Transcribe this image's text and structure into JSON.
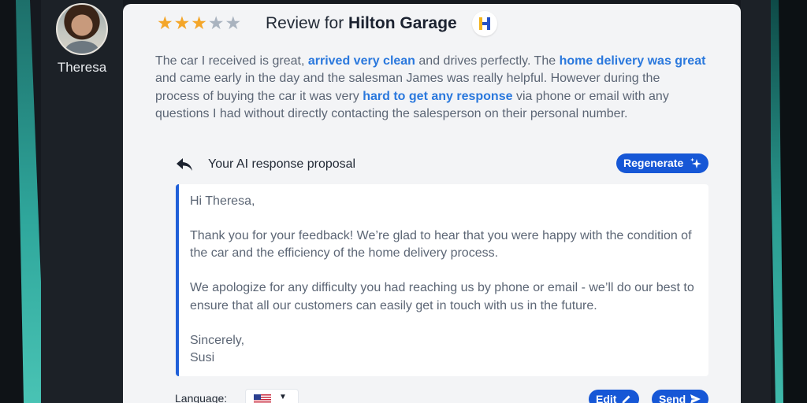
{
  "reviewer": {
    "name": "Theresa"
  },
  "review": {
    "rating": 3,
    "max_rating": 5,
    "title_prefix": "Review for",
    "business_name": "Hilton Garage",
    "text_segments": [
      {
        "text": "The car I received is great, ",
        "highlight": false
      },
      {
        "text": "arrived very clean",
        "highlight": true
      },
      {
        "text": " and drives perfectly. The ",
        "highlight": false
      },
      {
        "text": "home delivery was great",
        "highlight": true
      },
      {
        "text": " and came early in the day and the salesman James was really helpful. However during the process of buying the car it was very ",
        "highlight": false
      },
      {
        "text": "hard to get any response",
        "highlight": true
      },
      {
        "text": " via phone or email with any questions I had without directly contacting the salesperson on their personal number.",
        "highlight": false
      }
    ]
  },
  "ai_response": {
    "label": "Your AI response proposal",
    "regenerate_label": "Regenerate",
    "paragraphs": [
      "Hi Theresa,",
      "Thank you for your feedback! We’re glad to hear that you were happy with the condition of the car and the efficiency of the home delivery process.",
      "We apologize for any difficulty you had reaching us by phone or email - we’ll do our best to ensure that all our customers can easily get in touch with us in the future.",
      "Sincerely,\nSusi"
    ]
  },
  "footer": {
    "language_label": "Language:",
    "language_icon": "us-flag-icon",
    "edit_label": "Edit",
    "send_label": "Send"
  },
  "colors": {
    "accent": "#1657d6",
    "highlight": "#2a78dd",
    "star_on": "#f4a629",
    "star_off": "#a9b3bf"
  }
}
